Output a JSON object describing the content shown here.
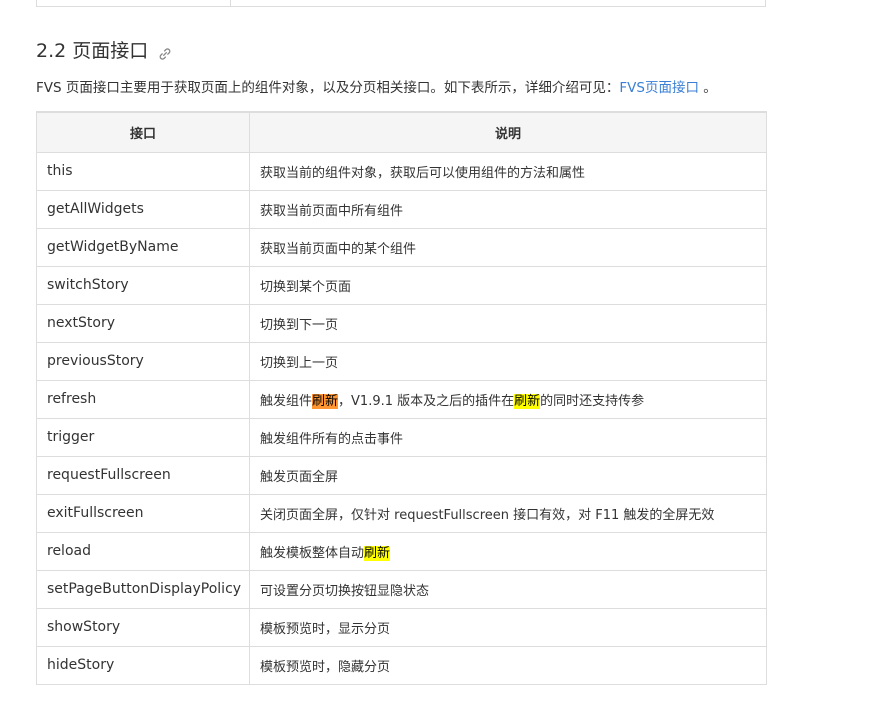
{
  "section": {
    "heading": "2.2 页面接口",
    "anchor_icon": "link-icon",
    "intro_before": "FVS 页面接口主要用于获取页面上的组件对象，以及分页相关接口。如下表所示，详细介绍可见：",
    "intro_link": "FVS页面接口",
    "intro_after": " 。"
  },
  "table": {
    "headers": [
      "接口",
      "说明"
    ],
    "rows": [
      {
        "name": "this",
        "desc": "获取当前的组件对象，获取后可以使用组件的方法和属性"
      },
      {
        "name": "getAllWidgets",
        "desc": "获取当前页面中所有组件"
      },
      {
        "name": "getWidgetByName",
        "desc": "获取当前页面中的某个组件"
      },
      {
        "name": "switchStory",
        "desc": "切换到某个页面"
      },
      {
        "name": "nextStory",
        "desc": "切换到下一页"
      },
      {
        "name": "previousStory",
        "desc": "切换到上一页"
      },
      {
        "name": "refresh",
        "desc_parts": [
          "触发组件",
          "刷新",
          "，V1.9.1 版本及之后的插件在",
          "刷新",
          "的同时还支持传参"
        ]
      },
      {
        "name": "trigger",
        "desc": "触发组件所有的点击事件"
      },
      {
        "name": "requestFullscreen",
        "desc": "触发页面全屏"
      },
      {
        "name": "exitFullscreen",
        "desc": "关闭页面全屏，仅针对 requestFullscreen 接口有效，对 F11 触发的全屏无效"
      },
      {
        "name": "reload",
        "desc_parts": [
          "触发模板整体自动",
          "刷新"
        ]
      },
      {
        "name": "setPageButtonDisplayPolicy",
        "desc": "可设置分页切换按钮显隐状态"
      },
      {
        "name": "showStory",
        "desc": "模板预览时，显示分页"
      },
      {
        "name": "hideStory",
        "desc": "模板预览时，隐藏分页"
      }
    ]
  },
  "colors": {
    "link": "#3a7fd5",
    "highlight_current": "#ff9632",
    "highlight_other": "#ffff00",
    "border": "#dddddd",
    "header_bg": "#f5f5f5"
  }
}
